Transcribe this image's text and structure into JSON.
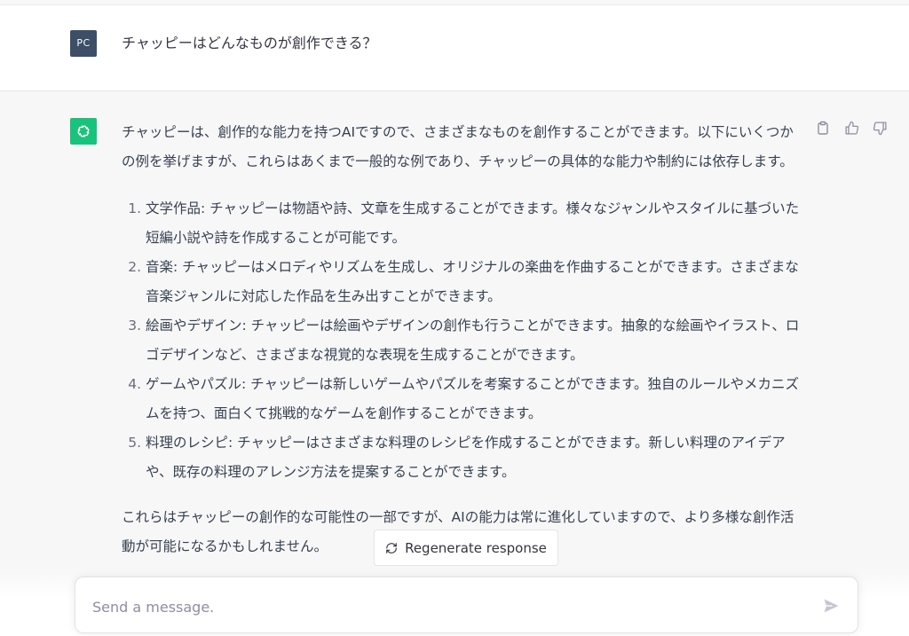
{
  "user_message": {
    "avatar_initials": "PC",
    "text": "チャッピーはどんなものが創作できる？"
  },
  "assistant_message": {
    "avatar_icon": "openai-logo-icon",
    "intro": "チャッピーは、創作的な能力を持つAIですので、さまざまなものを創作することができます。以下にいくつかの例を挙げますが、これらはあくまで一般的な例であり、チャッピーの具体的な能力や制約には依存します。",
    "items": [
      "文学作品: チャッピーは物語や詩、文章を生成することができます。様々なジャンルやスタイルに基づいた短編小説や詩を作成することが可能です。",
      "音楽: チャッピーはメロディやリズムを生成し、オリジナルの楽曲を作曲することができます。さまざまな音楽ジャンルに対応した作品を生み出すことができます。",
      "絵画やデザイン: チャッピーは絵画やデザインの創作も行うことができます。抽象的な絵画やイラスト、ロゴデザインなど、さまざまな視覚的な表現を生成することができます。",
      "ゲームやパズル: チャッピーは新しいゲームやパズルを考案することができます。独自のルールやメカニズムを持つ、面白くて挑戦的なゲームを創作することができます。",
      "料理のレシピ: チャッピーはさまざまな料理のレシピを作成することができます。新しい料理のアイデアや、既存の料理のアレンジ方法を提案することができます。"
    ],
    "outro": "これらはチャッピーの創作的な可能性の一部ですが、AIの能力は常に進化していますので、より多様な創作活動が可能になるかもしれません。",
    "actions": [
      "clipboard-icon",
      "thumbs-up-icon",
      "thumbs-down-icon"
    ]
  },
  "regenerate": {
    "label": "Regenerate response",
    "icon": "refresh-icon"
  },
  "composer": {
    "placeholder": "Send a message.",
    "send_icon": "send-icon"
  },
  "colors": {
    "bot_avatar": "#19c37d",
    "user_avatar": "#3c4f66",
    "assistant_bg": "#f7f7f8"
  }
}
